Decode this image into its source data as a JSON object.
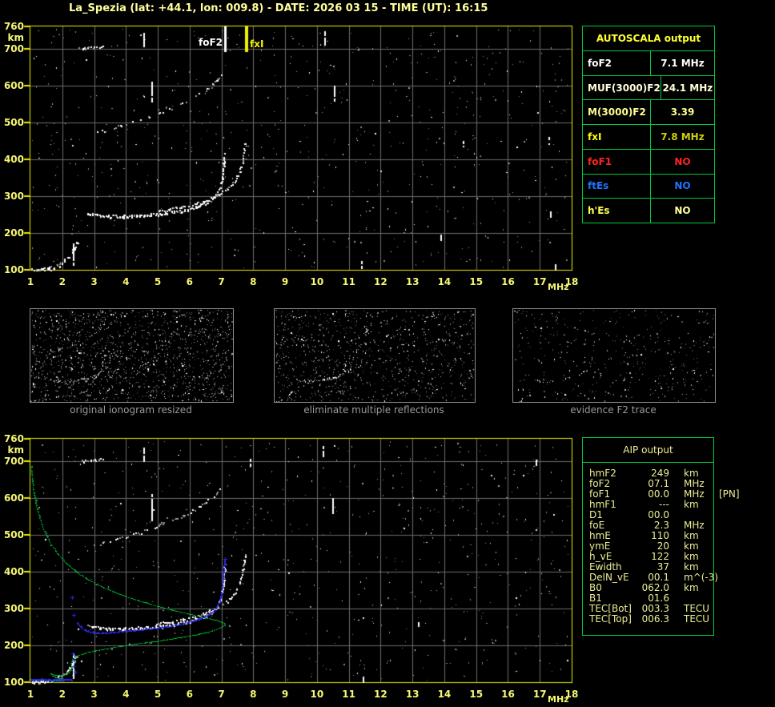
{
  "title": "La_Spezia (lat: +44.1, lon: 009.8) - DATE: 2026 03 15 - TIME (UT): 16:15",
  "colors": {
    "title": "#FFFF9E",
    "axis": "#F7F776",
    "plot_border": "#EDED00",
    "grid": "#6C6C6C",
    "table_border": "#00C83C",
    "green_trace": "#00C436",
    "blue_trace": "#2A2AE6",
    "caption": "#9A9A9A",
    "thumb_border": "#8C8C8C",
    "aip_text": "#EDED96",
    "marker_white": "#FFFFFF",
    "marker_yellow": "#F2F200"
  },
  "axis": {
    "x_ticks": [
      "1",
      "2",
      "3",
      "4",
      "5",
      "6",
      "7",
      "8",
      "9",
      "10",
      "11",
      "12",
      "13",
      "14",
      "15",
      "16",
      "17",
      "18"
    ],
    "x_unit": "MHz",
    "y_ticks": [
      "760",
      "700",
      "600",
      "500",
      "400",
      "300",
      "200",
      "100"
    ],
    "y_unit": "km",
    "x_range": [
      1,
      18
    ],
    "y_range": [
      100,
      760
    ]
  },
  "top_plot": {
    "foF2_label": "foF2",
    "fxI_label": "fxI"
  },
  "autoscala": {
    "header": "AUTOSCALA output",
    "rows": [
      {
        "label": "foF2",
        "value": "7.1 MHz",
        "label_color": "#FFFFFF",
        "value_color": "#FFFFFF"
      },
      {
        "label": "MUF(3000)F2",
        "value": "24.1 MHz",
        "label_color": "#FFFFD9",
        "value_color": "#FFFFD9"
      },
      {
        "label": "M(3000)F2",
        "value": "3.39",
        "label_color": "#FFFF8F",
        "value_color": "#FFFF8F"
      },
      {
        "label": "fxI",
        "value": "7.8 MHz",
        "label_color": "#FFFF00",
        "value_color": "#CDCD10"
      },
      {
        "label": "foF1",
        "value": "NO",
        "label_color": "#FF2222",
        "value_color": "#FF2222"
      },
      {
        "label": "ftEs",
        "value": "NO",
        "label_color": "#1F75FF",
        "value_color": "#1F75FF"
      },
      {
        "label": "h'Es",
        "value": "NO",
        "label_color": "#FFFF55",
        "value_color": "#FFFF99"
      }
    ]
  },
  "thumbnails": [
    {
      "caption": "original ionogram resized"
    },
    {
      "caption": "eliminate multiple reflections"
    },
    {
      "caption": "evidence F2 trace"
    }
  ],
  "aip": {
    "header": "AIP output",
    "rows": [
      {
        "name": "hmF2",
        "value": "249",
        "unit": "km",
        "extra": ""
      },
      {
        "name": "foF2",
        "value": "07.1",
        "unit": "MHz",
        "extra": ""
      },
      {
        "name": "foF1",
        "value": "00.0",
        "unit": "MHz",
        "extra": "[PN]"
      },
      {
        "name": "hmF1",
        "value": "---",
        "unit": "km",
        "extra": ""
      },
      {
        "name": "D1",
        "value": "00.0",
        "unit": "",
        "extra": ""
      },
      {
        "name": "foE",
        "value": "2.3",
        "unit": "MHz",
        "extra": ""
      },
      {
        "name": "hmE",
        "value": "110",
        "unit": "km",
        "extra": ""
      },
      {
        "name": "ymE",
        "value": "20",
        "unit": "km",
        "extra": ""
      },
      {
        "name": "h_vE",
        "value": "122",
        "unit": "km",
        "extra": ""
      },
      {
        "name": "Ewidth",
        "value": "37",
        "unit": "km",
        "extra": ""
      },
      {
        "name": "DelN_vE",
        "value": "00.1",
        "unit": "m^(-3)",
        "extra": ""
      },
      {
        "name": "B0",
        "value": "062.0",
        "unit": "km",
        "extra": ""
      },
      {
        "name": "B1",
        "value": "01.6",
        "unit": "",
        "extra": ""
      },
      {
        "name": "TEC[Bot]",
        "value": "003.3",
        "unit": "TECU",
        "extra": ""
      },
      {
        "name": "TEC[Top]",
        "value": "006.3",
        "unit": "TECU",
        "extra": ""
      }
    ]
  },
  "chart_data": {
    "type": "scatter",
    "description": "Ionogram echoes (virtual height km vs sounding frequency MHz) with Autoscala-scaled trace (blue), modeled electron density profile (green) and scaled characteristic markers.",
    "x_axis": {
      "label": "MHz",
      "range": [
        1,
        18
      ],
      "ticks": [
        1,
        2,
        3,
        4,
        5,
        6,
        7,
        8,
        9,
        10,
        11,
        12,
        13,
        14,
        15,
        16,
        17,
        18
      ]
    },
    "y_axis": {
      "label": "km",
      "range": [
        100,
        760
      ],
      "ticks": [
        760,
        700,
        600,
        500,
        400,
        300,
        200,
        100
      ]
    },
    "markers": {
      "foF2_mhz": 7.1,
      "fxI_mhz": 7.8
    },
    "traces": {
      "e_layer": [
        [
          1.0,
          99
        ],
        [
          1.2,
          100
        ],
        [
          1.45,
          103
        ],
        [
          1.7,
          108
        ],
        [
          1.9,
          115
        ],
        [
          2.05,
          124
        ],
        [
          2.18,
          136
        ],
        [
          2.3,
          152
        ],
        [
          2.4,
          166
        ],
        [
          2.47,
          176
        ]
      ],
      "f2_ordinary": [
        [
          2.78,
          257
        ],
        [
          2.95,
          251
        ],
        [
          3.2,
          248
        ],
        [
          3.5,
          246
        ],
        [
          3.9,
          246
        ],
        [
          4.3,
          248
        ],
        [
          4.7,
          250
        ],
        [
          5.1,
          253
        ],
        [
          5.5,
          258
        ],
        [
          5.9,
          264
        ],
        [
          6.2,
          271
        ],
        [
          6.5,
          281
        ],
        [
          6.7,
          293
        ],
        [
          6.85,
          307
        ],
        [
          6.95,
          326
        ],
        [
          7.02,
          352
        ],
        [
          7.06,
          385
        ],
        [
          7.09,
          418
        ]
      ],
      "f2_extraordinary": [
        [
          4.95,
          261
        ],
        [
          5.35,
          265
        ],
        [
          5.75,
          271
        ],
        [
          6.15,
          279
        ],
        [
          6.5,
          289
        ],
        [
          6.85,
          302
        ],
        [
          7.15,
          318
        ],
        [
          7.4,
          340
        ],
        [
          7.55,
          365
        ],
        [
          7.65,
          395
        ],
        [
          7.7,
          425
        ],
        [
          7.73,
          450
        ]
      ],
      "f2_second_hop": [
        [
          2.95,
          470
        ],
        [
          3.25,
          478
        ],
        [
          3.6,
          487
        ],
        [
          4.0,
          497
        ],
        [
          4.45,
          508
        ],
        [
          4.9,
          521
        ],
        [
          5.35,
          536
        ],
        [
          5.8,
          553
        ],
        [
          6.2,
          572
        ],
        [
          6.55,
          592
        ],
        [
          6.85,
          615
        ],
        [
          7.05,
          640
        ]
      ],
      "top_blob": [
        [
          2.62,
          702
        ],
        [
          3.25,
          706
        ]
      ],
      "interference_dashes_top": [
        [
          4.57,
          705,
          748
        ],
        [
          4.82,
          556,
          610
        ],
        [
          2.37,
          112,
          172
        ],
        [
          10.25,
          712,
          748
        ],
        [
          10.55,
          560,
          600
        ],
        [
          11.4,
          106,
          124
        ],
        [
          13.9,
          178,
          196
        ],
        [
          14.6,
          434,
          450
        ],
        [
          17.3,
          440,
          460
        ],
        [
          17.35,
          242,
          258
        ],
        [
          17.5,
          100,
          116
        ]
      ],
      "interference_dashes_bottom": [
        [
          4.57,
          700,
          740
        ],
        [
          4.82,
          540,
          610
        ],
        [
          2.37,
          112,
          178
        ],
        [
          7.92,
          688,
          706
        ],
        [
          10.2,
          712,
          740
        ],
        [
          10.5,
          560,
          600
        ],
        [
          11.45,
          100,
          116
        ],
        [
          13.2,
          246,
          262
        ],
        [
          16.9,
          690,
          704
        ]
      ],
      "green_profile": [
        [
          1.03,
          686
        ],
        [
          1.06,
          650
        ],
        [
          1.11,
          614
        ],
        [
          1.19,
          578
        ],
        [
          1.3,
          543
        ],
        [
          1.44,
          510
        ],
        [
          1.62,
          478
        ],
        [
          1.85,
          449
        ],
        [
          2.12,
          422
        ],
        [
          2.45,
          398
        ],
        [
          2.85,
          376
        ],
        [
          3.3,
          356
        ],
        [
          3.8,
          338
        ],
        [
          4.35,
          322
        ],
        [
          4.9,
          308
        ],
        [
          5.45,
          295
        ],
        [
          6.0,
          284
        ],
        [
          6.5,
          274
        ],
        [
          6.9,
          266
        ],
        [
          7.08,
          260
        ],
        [
          7.1,
          254
        ],
        [
          6.95,
          246
        ],
        [
          6.65,
          237
        ],
        [
          6.2,
          228
        ],
        [
          5.65,
          220
        ],
        [
          5.0,
          211
        ],
        [
          4.3,
          203
        ],
        [
          3.65,
          194
        ],
        [
          3.1,
          186
        ],
        [
          2.7,
          178
        ],
        [
          2.45,
          170
        ],
        [
          2.33,
          161
        ],
        [
          2.28,
          152
        ],
        [
          2.3,
          143
        ],
        [
          2.28,
          134
        ],
        [
          2.22,
          126
        ],
        [
          2.1,
          120
        ],
        [
          1.93,
          117
        ],
        [
          1.76,
          119
        ],
        [
          1.65,
          123
        ],
        [
          1.68,
          117
        ],
        [
          1.8,
          112
        ],
        [
          1.98,
          109
        ],
        [
          2.12,
          106
        ],
        [
          1.95,
          104
        ],
        [
          1.7,
          104
        ],
        [
          1.4,
          104
        ],
        [
          1.05,
          103
        ]
      ],
      "blue_e_line": {
        "mhz_start": 1.0,
        "mhz_end": 2.28,
        "km": 108
      },
      "blue_isolated": [
        [
          2.3,
          330
        ],
        [
          2.36,
          282
        ],
        [
          2.33,
          178
        ],
        [
          2.35,
          160
        ],
        [
          2.37,
          144
        ],
        [
          2.4,
          128
        ]
      ],
      "blue_chain": [
        [
          2.48,
          260
        ],
        [
          2.58,
          251
        ],
        [
          2.7,
          244
        ],
        [
          2.82,
          239
        ],
        [
          2.95,
          236
        ],
        [
          3.1,
          234
        ],
        [
          3.3,
          234
        ],
        [
          3.55,
          236
        ],
        [
          3.8,
          238
        ],
        [
          4.05,
          240
        ],
        [
          4.3,
          242
        ],
        [
          4.55,
          244
        ],
        [
          4.8,
          246
        ],
        [
          5.05,
          249
        ],
        [
          5.3,
          252
        ],
        [
          5.55,
          256
        ],
        [
          5.8,
          260
        ],
        [
          6.05,
          265
        ],
        [
          6.25,
          271
        ],
        [
          6.45,
          277
        ],
        [
          6.6,
          284
        ],
        [
          6.75,
          293
        ],
        [
          6.87,
          305
        ],
        [
          6.95,
          320
        ],
        [
          7.0,
          340
        ],
        [
          7.04,
          362
        ],
        [
          7.06,
          385
        ],
        [
          7.08,
          405
        ],
        [
          7.1,
          422
        ],
        [
          7.11,
          435
        ]
      ],
      "white_e_underline": [
        [
          1.05,
          101
        ],
        [
          1.75,
          101
        ]
      ]
    }
  }
}
